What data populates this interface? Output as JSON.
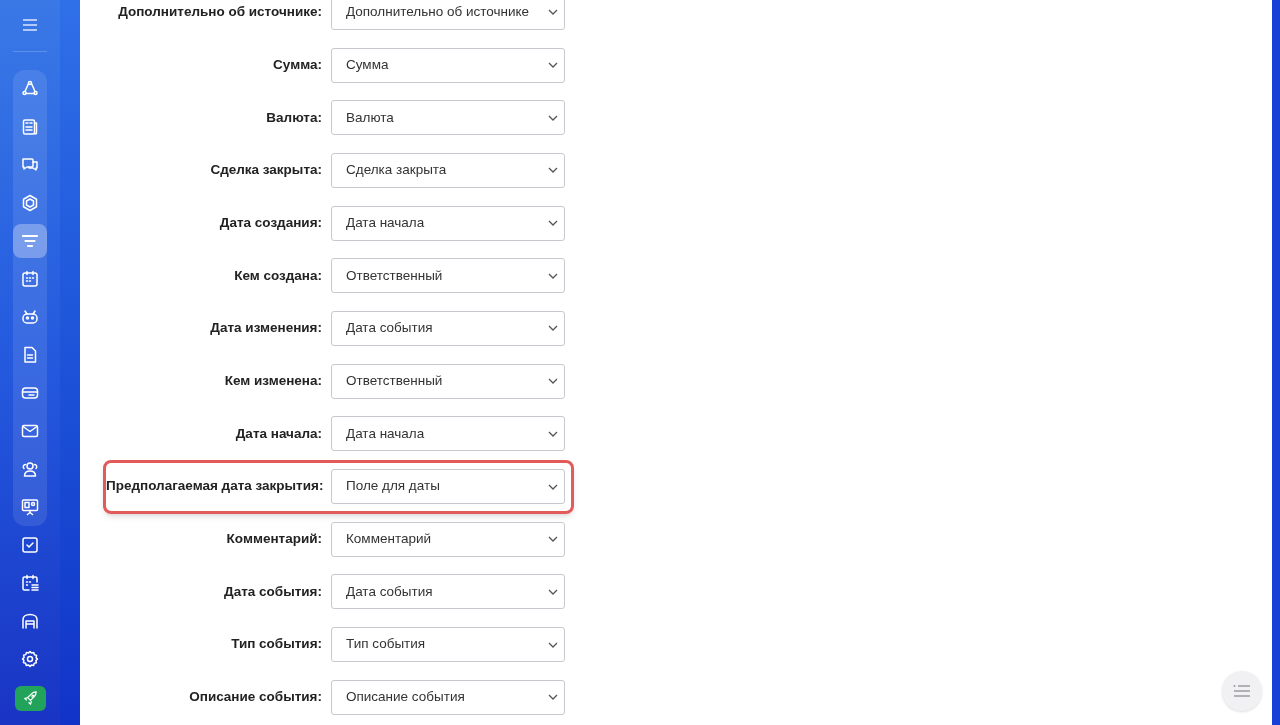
{
  "sidebar": {
    "panel_items": [
      {
        "selected": false
      },
      {
        "selected": false
      },
      {
        "selected": false
      },
      {
        "selected": false
      },
      {
        "selected": true
      },
      {
        "selected": false
      },
      {
        "selected": false
      },
      {
        "selected": false
      },
      {
        "selected": false
      },
      {
        "selected": false
      },
      {
        "selected": false
      },
      {
        "selected": false
      }
    ],
    "items": [
      {
        "selected": false
      },
      {
        "selected": false
      },
      {
        "selected": false
      },
      {
        "selected": false
      }
    ]
  },
  "fields": [
    {
      "label": "Дополнительно об источнике:",
      "value": "Дополнительно об источнике",
      "highlighted": false
    },
    {
      "label": "Сумма:",
      "value": "Сумма",
      "highlighted": false
    },
    {
      "label": "Валюта:",
      "value": "Валюта",
      "highlighted": false
    },
    {
      "label": "Сделка закрыта:",
      "value": "Сделка закрыта",
      "highlighted": false
    },
    {
      "label": "Дата создания:",
      "value": "Дата начала",
      "highlighted": false
    },
    {
      "label": "Кем создана:",
      "value": "Ответственный",
      "highlighted": false
    },
    {
      "label": "Дата изменения:",
      "value": "Дата события",
      "highlighted": false
    },
    {
      "label": "Кем изменена:",
      "value": "Ответственный",
      "highlighted": false
    },
    {
      "label": "Дата начала:",
      "value": "Дата начала",
      "highlighted": false
    },
    {
      "label": "Предполагаемая дата закрытия:",
      "value": "Поле для даты",
      "highlighted": true
    },
    {
      "label": "Комментарий:",
      "value": "Комментарий",
      "highlighted": false
    },
    {
      "label": "Дата события:",
      "value": "Дата события",
      "highlighted": false
    },
    {
      "label": "Тип события:",
      "value": "Тип события",
      "highlighted": false
    },
    {
      "label": "Описание события:",
      "value": "Описание события",
      "highlighted": false
    }
  ]
}
